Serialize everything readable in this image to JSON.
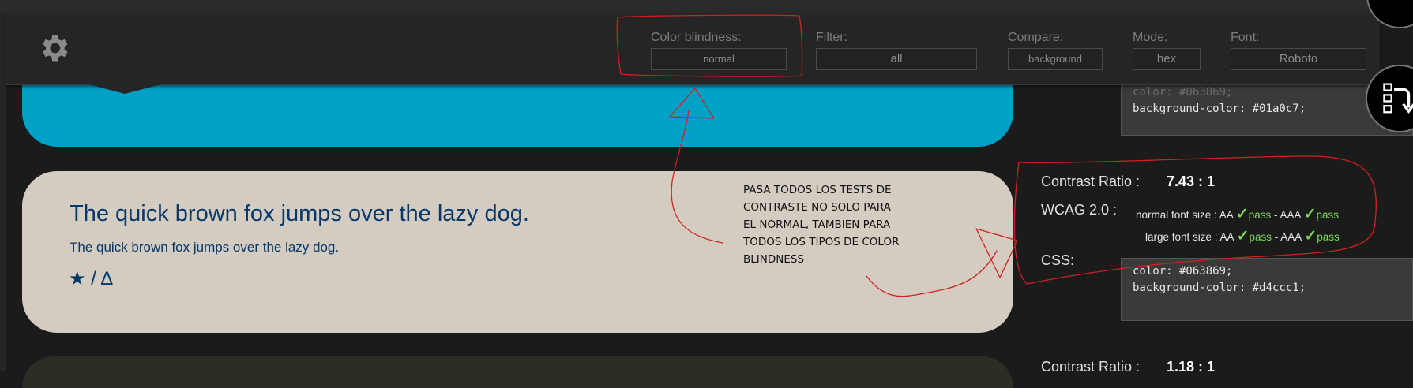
{
  "toolbar": {
    "controls": [
      {
        "label": "Color blindness:",
        "value": "normal"
      },
      {
        "label": "Filter:",
        "value": "all"
      },
      {
        "label": "Compare:",
        "value": "background"
      },
      {
        "label": "Mode:",
        "value": "hex"
      },
      {
        "label": "Font:",
        "value": "Roboto"
      }
    ]
  },
  "sample": {
    "heading": "The quick brown fox jumps over the lazy dog.",
    "body": "The quick brown fox jumps over the lazy dog.",
    "icons": "★ / Δ",
    "text_color": "#063869",
    "background_color": "#d4ccc1"
  },
  "previous_card": {
    "css_partial": "color: #063869;",
    "css_background": "background-color: #01a0c7;",
    "background_color": "#01a0c7"
  },
  "current_result": {
    "ratio_label": "Contrast Ratio :",
    "ratio_value": "7.43 : 1",
    "wcag_label": "WCAG 2.0 :",
    "normal_prefix": "normal font size : AA ",
    "large_prefix": "large font size : AA ",
    "pass_text": "pass",
    "sep_aaa": " - AAA ",
    "check": "✓",
    "css_label": "CSS:",
    "css_lines": [
      "color: #063869;",
      "background-color: #d4ccc1;"
    ]
  },
  "next_result": {
    "ratio_label": "Contrast Ratio :",
    "ratio_value": "1.18 : 1"
  },
  "annotation": {
    "note": "Pasa todos los tests de contraste no solo para el normal, tambien para todos los tipos de color blindness",
    "color": "#d32020"
  },
  "icons": {
    "gear": "gear-icon",
    "layout_switch": "layout-switch-icon"
  }
}
